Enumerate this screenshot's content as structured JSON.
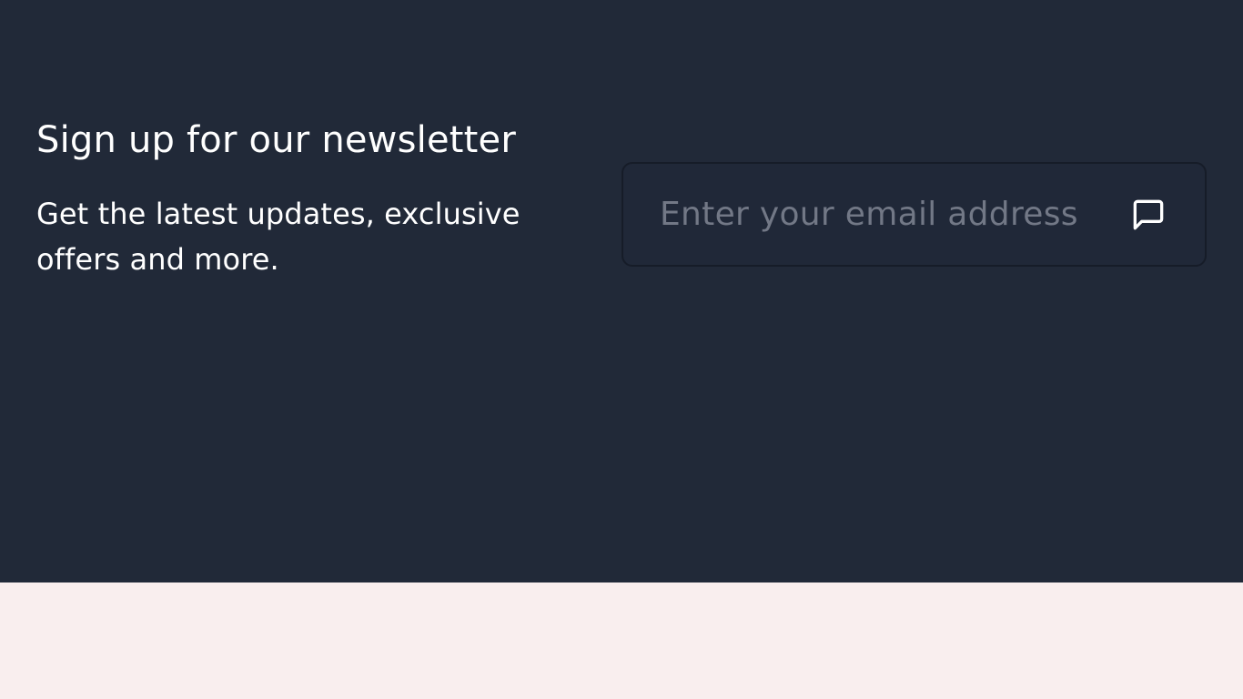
{
  "newsletter": {
    "title": "Sign up for our newsletter",
    "subtitle": "Get the latest updates, exclusive offers and more.",
    "email": {
      "value": "",
      "placeholder": "Enter your email address"
    },
    "submit_icon": "message-square-icon"
  },
  "colors": {
    "section_bg": "#212938",
    "footer_bg": "#f9eeee",
    "text": "#ffffff",
    "placeholder": "#727886",
    "input_border": "#161c28"
  }
}
